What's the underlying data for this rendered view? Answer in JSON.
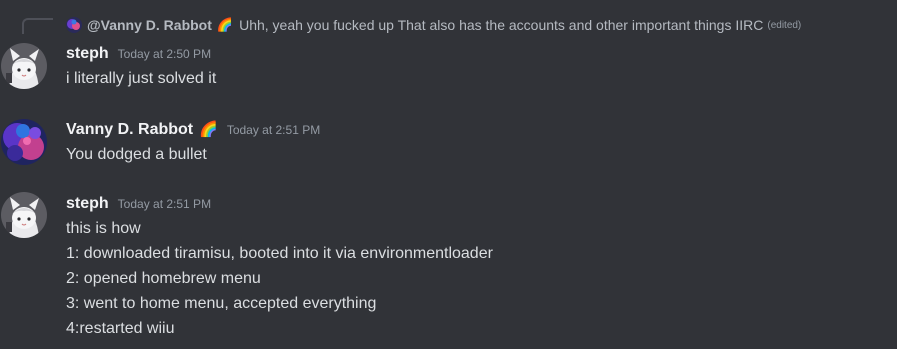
{
  "reply": {
    "author": "@Vanny D. Rabbot",
    "emoji": "🌈",
    "text": "Uhh, yeah you fucked up That also has the accounts and other important things IIRC",
    "edited": "(edited)"
  },
  "messages": [
    {
      "username": "steph",
      "timestamp": "Today at 2:50 PM",
      "lines": [
        "i literally just solved it"
      ]
    },
    {
      "username": "Vanny D. Rabbot",
      "emoji": "🌈",
      "timestamp": "Today at 2:51 PM",
      "lines": [
        "You dodged a bullet"
      ]
    },
    {
      "username": "steph",
      "timestamp": "Today at 2:51 PM",
      "lines": [
        "this is how",
        "1: downloaded tiramisu, booted into it via environmentloader",
        "2: opened homebrew menu",
        "3: went to home menu, accepted everything",
        "4:restarted wiiu"
      ]
    }
  ],
  "colors": {
    "background": "#313338",
    "username": "#f2f3f5",
    "text": "#dbdee1",
    "timestamp": "#949ba4"
  }
}
